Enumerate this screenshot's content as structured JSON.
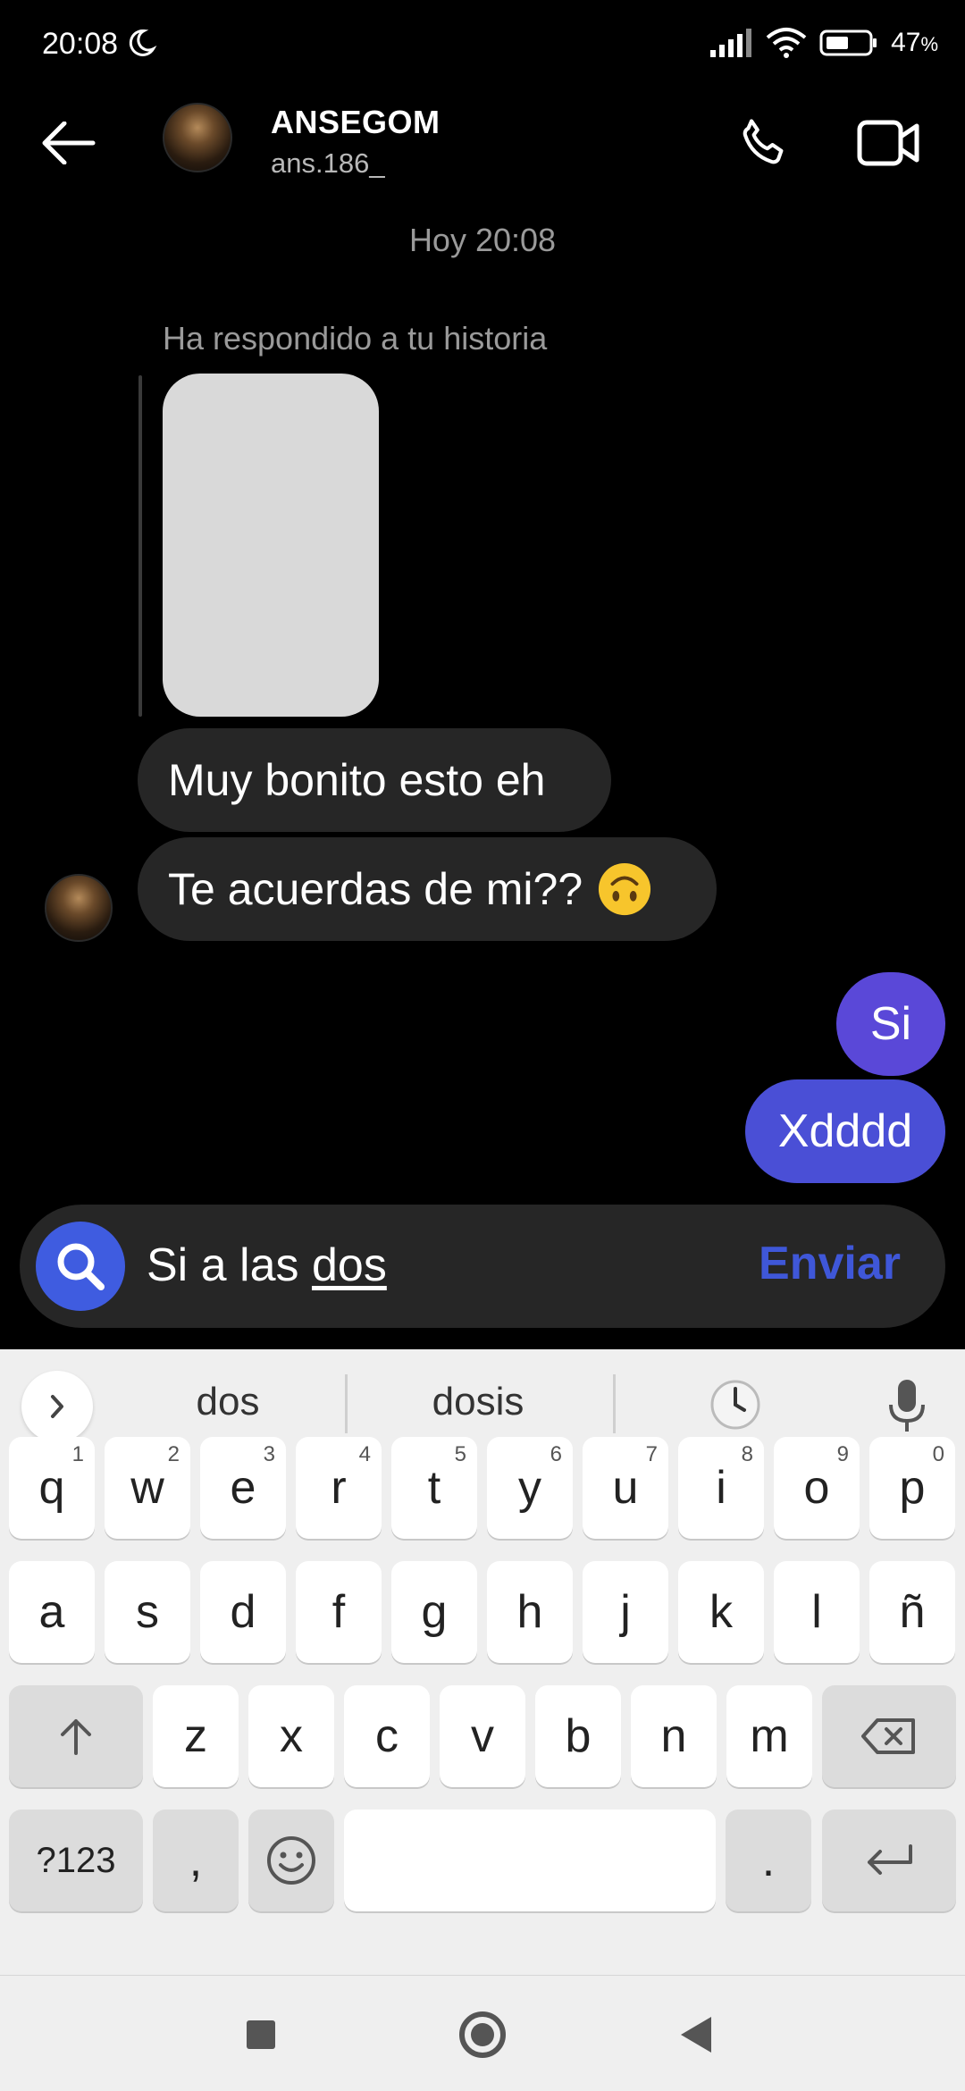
{
  "status_bar": {
    "time": "20:08",
    "battery": "47",
    "battery_unit": "%",
    "icons": [
      "moon-icon",
      "signal-icon",
      "wifi-icon",
      "battery-icon"
    ]
  },
  "header": {
    "name": "ANSEGOM",
    "username": "ans.186_",
    "icons": [
      "back-arrow-icon",
      "phone-icon",
      "video-camera-icon"
    ]
  },
  "chat": {
    "timestamp": "Hoy 20:08",
    "reply_note": "Ha respondido a tu historia",
    "received": [
      {
        "text": "Muy bonito esto eh"
      },
      {
        "text": "Te acuerdas de mi??",
        "emoji": "upside-down-face-emoji"
      }
    ],
    "sent": [
      {
        "text": "Si"
      },
      {
        "text": "Xdddd"
      }
    ],
    "colors": {
      "received_bubble": "#262626",
      "sent_bubble": "#5a48d8",
      "background": "#000000"
    }
  },
  "composer": {
    "text_prefix": "Si a las ",
    "text_underlined": "dos",
    "send_label": "Enviar",
    "send_color": "#3f57d8",
    "icon": "search-icon"
  },
  "keyboard": {
    "suggestions": [
      "dos",
      "dosis"
    ],
    "row1": [
      [
        "q",
        "1"
      ],
      [
        "w",
        "2"
      ],
      [
        "e",
        "3"
      ],
      [
        "r",
        "4"
      ],
      [
        "t",
        "5"
      ],
      [
        "y",
        "6"
      ],
      [
        "u",
        "7"
      ],
      [
        "i",
        "8"
      ],
      [
        "o",
        "9"
      ],
      [
        "p",
        "0"
      ]
    ],
    "row2": [
      "a",
      "s",
      "d",
      "f",
      "g",
      "h",
      "j",
      "k",
      "l",
      "ñ"
    ],
    "row3": [
      "z",
      "x",
      "c",
      "v",
      "b",
      "n",
      "m"
    ],
    "symbols_label": "?123",
    "comma": ",",
    "period": "."
  }
}
